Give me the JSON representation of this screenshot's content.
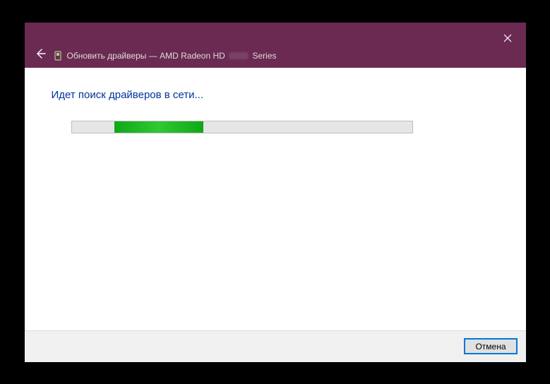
{
  "titlebar": {
    "title_prefix": "Обновить драйверы — AMD Radeon HD",
    "title_suffix": "Series"
  },
  "content": {
    "heading": "Идет поиск драйверов в сети..."
  },
  "footer": {
    "cancel_label": "Отмена"
  },
  "icons": {
    "close": "close-icon",
    "back": "back-arrow-icon",
    "device": "device-chip-icon"
  }
}
